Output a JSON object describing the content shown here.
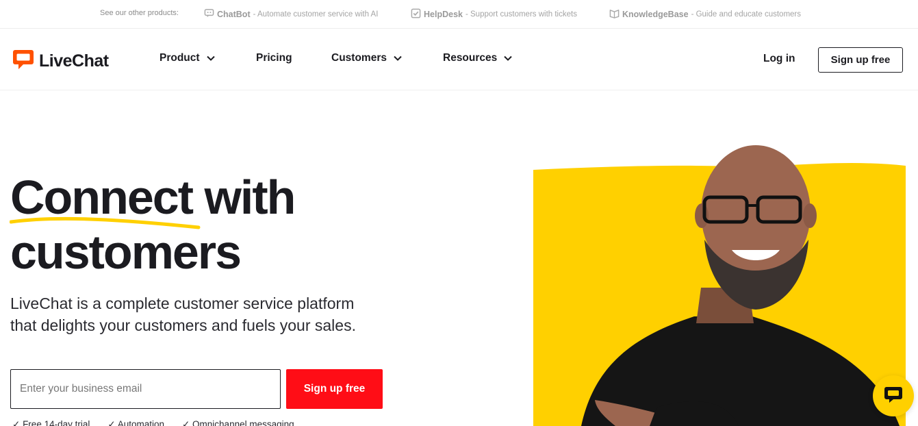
{
  "topbar": {
    "see_other": "See our other products:",
    "products": [
      {
        "name": "ChatBot",
        "desc": "- Automate customer service with AI",
        "icon": "chatbot-icon"
      },
      {
        "name": "HelpDesk",
        "desc": "- Support customers with tickets",
        "icon": "helpdesk-icon"
      },
      {
        "name": "KnowledgeBase",
        "desc": "- Guide and educate customers",
        "icon": "knowledgebase-icon"
      }
    ]
  },
  "nav": {
    "logo": "LiveChat",
    "items": [
      {
        "label": "Product",
        "has_dropdown": true
      },
      {
        "label": "Pricing",
        "has_dropdown": false
      },
      {
        "label": "Customers",
        "has_dropdown": true
      },
      {
        "label": "Resources",
        "has_dropdown": true
      }
    ],
    "login": "Log in",
    "signup": "Sign up free"
  },
  "hero": {
    "headline_line1": "Connect with",
    "headline_line2": "customers",
    "subtext": "LiveChat is a complete customer service platform that delights your customers and fuels your sales.",
    "email_placeholder": "Enter your business email",
    "signup": "Sign up free",
    "features": [
      "Free 14-day trial",
      "Automation",
      "Omnichannel messaging"
    ]
  },
  "colors": {
    "brand_orange": "#ff5100",
    "signup_red": "#ff0d16",
    "hero_yellow": "#ffd000",
    "text_dark": "#1b1b20"
  }
}
